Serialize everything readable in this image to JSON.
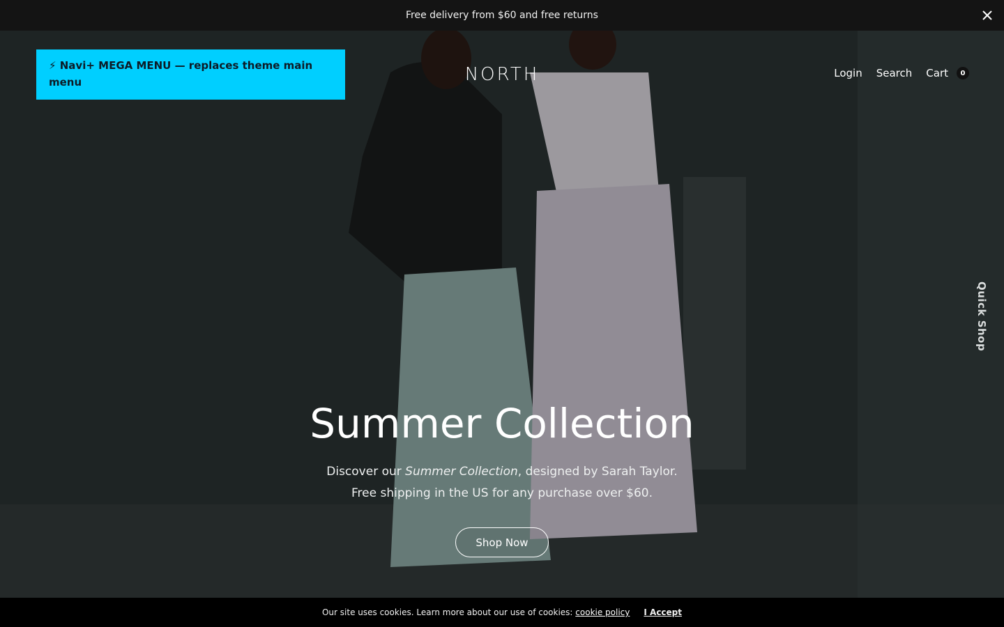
{
  "announcement": {
    "text": "Free delivery from $60 and free returns",
    "close_icon": "close-icon"
  },
  "header": {
    "mega_menu": "⚡ Navi+ MEGA MENU — replaces theme main menu",
    "logo": "NORTH",
    "nav": {
      "login": "Login",
      "search": "Search",
      "cart": "Cart",
      "cart_count": "0"
    }
  },
  "quick_shop": "Quick Shop",
  "hero": {
    "title": "Summer Collection",
    "desc_prefix": "Discover our ",
    "desc_em": "Summer Collection",
    "desc_suffix": ", designed by Sarah Taylor.",
    "desc_line2": "Free shipping in the US for any purchase over $60.",
    "cta": "Shop Now"
  },
  "cookie": {
    "text": "Our site uses cookies. Learn more about our use of cookies:",
    "link": "cookie policy",
    "accept": "I Accept"
  },
  "colors": {
    "mega_menu_bg": "#00cfff",
    "announce_bg": "#141414",
    "cookie_bg": "#000000"
  }
}
